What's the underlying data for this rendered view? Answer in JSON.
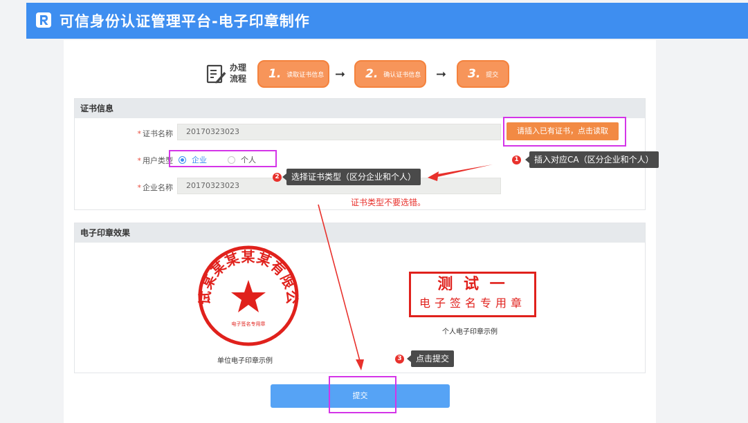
{
  "header": {
    "title": "可信身份认证管理平台-电子印章制作",
    "logo_icon": "r-logo-icon"
  },
  "flow": {
    "label_line1": "办理",
    "label_line2": "流程",
    "steps": [
      {
        "num": "1.",
        "text": "读取证书信息"
      },
      {
        "num": "2.",
        "text": "确认证书信息"
      },
      {
        "num": "3.",
        "text": "提交"
      }
    ]
  },
  "cert_panel": {
    "title": "证书信息",
    "cert_name_label": "证书名称",
    "cert_name_value": "20170323023",
    "read_button": "请插入已有证书，点击读取",
    "user_type_label": "用户类型",
    "user_type_options": [
      "企业",
      "个人"
    ],
    "user_type_selected": "企业",
    "company_name_label": "企业名称",
    "company_name_value": "20170323023",
    "required_mark": "*"
  },
  "annotations": {
    "tip1_num": "1",
    "tip1": "插入对应CA（区分企业和个人）",
    "tip2_num": "2",
    "tip2": "选择证书类型（区分企业和个人）",
    "warning": "证书类型不要选错。",
    "tip3_num": "3",
    "tip3": "点击提交"
  },
  "stamp_panel": {
    "title": "电子印章效果",
    "company_stamp_text": "测试某某某某某有限公司",
    "company_stamp_sub": "电子签名专用章",
    "company_caption": "单位电子印章示例",
    "personal_stamp_name": "测 试 一",
    "personal_stamp_sub": "电子签名专用章",
    "personal_caption": "个人电子印章示例"
  },
  "submit_label": "提交",
  "colors": {
    "header_blue": "#3e8ef0",
    "step_orange": "#f7955a",
    "stamp_red": "#e0211c",
    "highlight_magenta": "#d434e8",
    "tooltip_dark": "#4a4a4a",
    "submit_blue": "#56a3f5"
  }
}
